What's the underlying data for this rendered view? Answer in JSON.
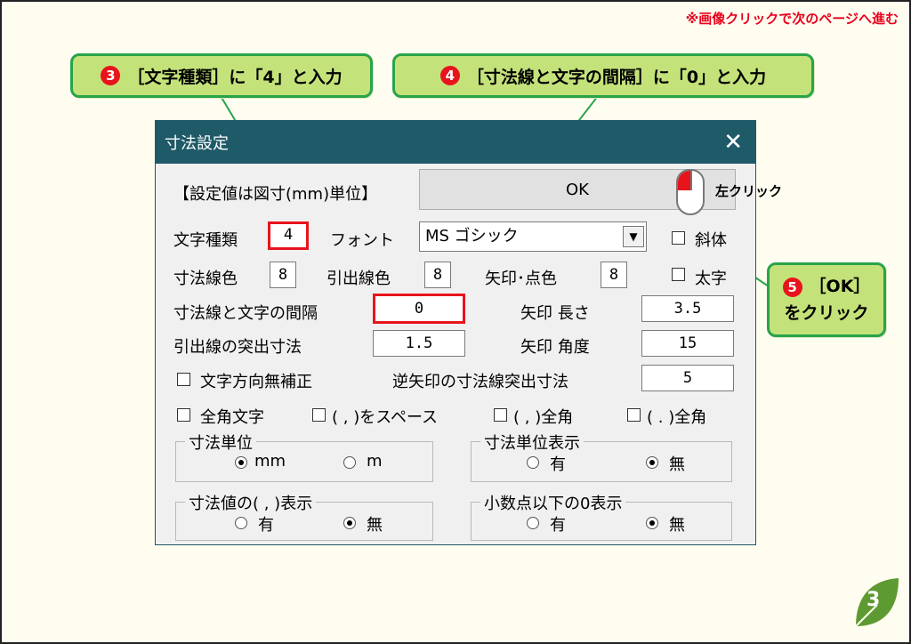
{
  "page": {
    "next_note": "※画像クリックで次のページへ進む",
    "page_number": "3"
  },
  "callouts": {
    "c3": {
      "num": "3",
      "text": "［文字種類］に「4」と入力"
    },
    "c4": {
      "num": "4",
      "text": "［寸法線と文字の間隔］に「0」と入力"
    },
    "c5": {
      "num": "5",
      "line1": "［OK］",
      "line2": "をクリック"
    },
    "mouse_label": "左クリック"
  },
  "dialog": {
    "title": "寸法設定",
    "close": "✕",
    "unit_note": "【設定値は図寸(mm)単位】",
    "ok_label": "OK",
    "char_type_label": "文字種類",
    "char_type_value": "4",
    "font_label": "フォント",
    "font_value": "MS ゴシック",
    "italic_label": "斜体",
    "bold_label": "太字",
    "dim_line_color_label": "寸法線色",
    "dim_line_color_value": "8",
    "leader_color_label": "引出線色",
    "leader_color_value": "8",
    "arrow_color_label": "矢印･点色",
    "arrow_color_value": "8",
    "gap_label": "寸法線と文字の間隔",
    "gap_value": "0",
    "arrow_len_label": "矢印  長さ",
    "arrow_len_value": "3.5",
    "leader_protrude_label": "引出線の突出寸法",
    "leader_protrude_value": "1.5",
    "arrow_angle_label": "矢印  角度",
    "arrow_angle_value": "15",
    "no_dir_fix_label": "文字方向無補正",
    "rev_arrow_label": "逆矢印の寸法線突出寸法",
    "rev_arrow_value": "5",
    "fullwidth_label": "全角文字",
    "comma_space_label": "( , )をスペース",
    "comma_full_label": "( , )全角",
    "dot_full_label": "( . )全角",
    "group_unit": {
      "title": "寸法単位",
      "opt1": "mm",
      "opt2": "m"
    },
    "group_unit_disp": {
      "title": "寸法単位表示",
      "opt1": "有",
      "opt2": "無"
    },
    "group_comma": {
      "title": "寸法値の( , )表示",
      "opt1": "有",
      "opt2": "無"
    },
    "group_zero": {
      "title": "小数点以下の0表示",
      "opt1": "有",
      "opt2": "無"
    }
  },
  "colors": {
    "accent_red": "#e8141c",
    "callout_bg": "#c4e27a",
    "callout_border": "#29a34a",
    "titlebar": "#1f5a68"
  }
}
